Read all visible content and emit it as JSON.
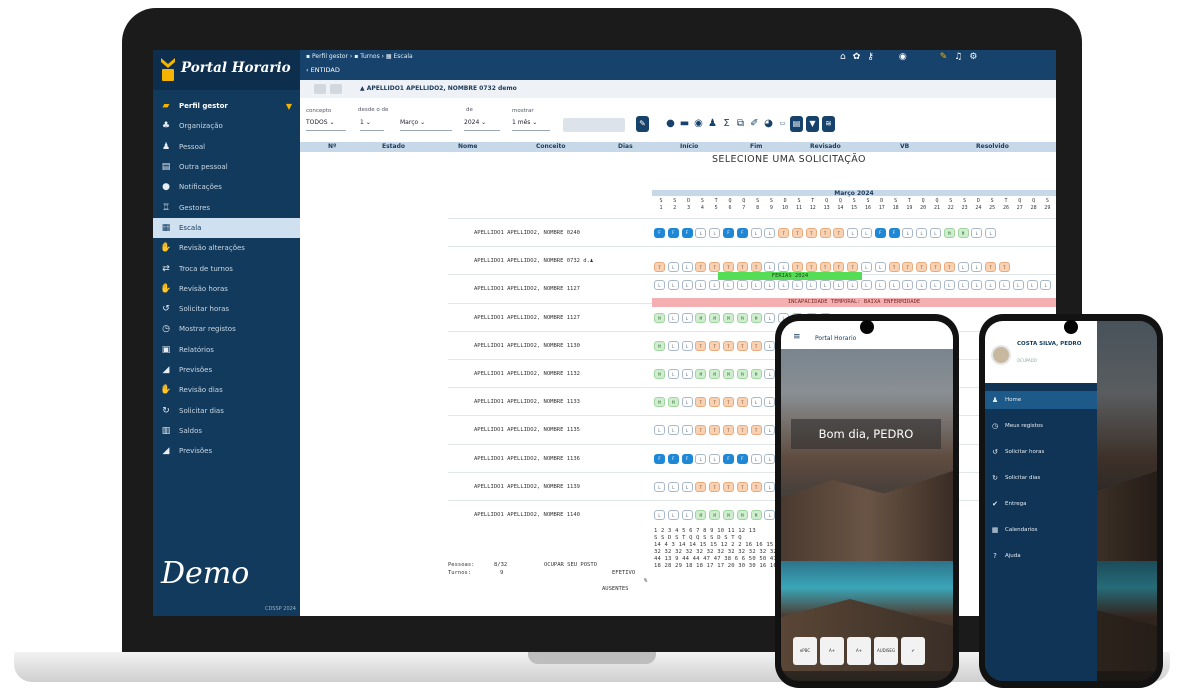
{
  "app": {
    "brand": "Portal Horario",
    "demo_label": "Demo",
    "copyright": "CDSSP 2024"
  },
  "sidebar": {
    "items": [
      {
        "label": "Perfil gestor",
        "icon": "briefcase-icon",
        "glyph": "▰"
      },
      {
        "label": "Organização",
        "icon": "org-chart-icon",
        "glyph": "♣"
      },
      {
        "label": "Pessoal",
        "icon": "people-icon",
        "glyph": "♟"
      },
      {
        "label": "Outra pessoal",
        "icon": "id-card-icon",
        "glyph": "▤"
      },
      {
        "label": "Notificações",
        "icon": "chat-icon",
        "glyph": "●"
      },
      {
        "label": "Gestores",
        "icon": "cart-icon",
        "glyph": "♖"
      },
      {
        "label": "Escala",
        "icon": "grid-icon",
        "glyph": "▦"
      },
      {
        "label": "Revisão alterações",
        "icon": "hand-icon",
        "glyph": "✋"
      },
      {
        "label": "Troca de turnos",
        "icon": "swap-icon",
        "glyph": "⇄"
      },
      {
        "label": "Revisão horas",
        "icon": "hand-icon",
        "glyph": "✋"
      },
      {
        "label": "Solicitar horas",
        "icon": "undo-icon",
        "glyph": "↺"
      },
      {
        "label": "Mostrar registos",
        "icon": "clock-icon",
        "glyph": "◷"
      },
      {
        "label": "Relatórios",
        "icon": "report-icon",
        "glyph": "▣"
      },
      {
        "label": "Previsões",
        "icon": "chart-icon",
        "glyph": "◢"
      },
      {
        "label": "Revisão dias",
        "icon": "hand-icon",
        "glyph": "✋"
      },
      {
        "label": "Solicitar dias",
        "icon": "refresh-icon",
        "glyph": "↻"
      },
      {
        "label": "Saldos",
        "icon": "balance-icon",
        "glyph": "▥"
      },
      {
        "label": "Previsões",
        "icon": "chart-icon",
        "glyph": "◢"
      }
    ]
  },
  "topbar": {
    "breadcrumb": "▪ Perfil gestor › ▪ Turnos › ▦ Escala",
    "entity": "‹ ENTIDAD",
    "icons": [
      "home-icon",
      "settings-icon",
      "key-icon",
      "globe-icon",
      "tools-icon",
      "headset-icon",
      "gear-icon"
    ]
  },
  "employee": {
    "name": "▲ APELLIDO1 APELLIDO2, NOMBRE 0732 demo"
  },
  "filters": {
    "labels": {
      "concepto": "concepto",
      "desde": "desde o  de",
      "de": "de",
      "mostrar": "mostrar"
    },
    "concepto": "TODOS  ⌄",
    "dia": "1  ⌄",
    "mes": "Março  ⌄",
    "ano": "2024  ⌄",
    "mostrar": "1 mês  ⌄"
  },
  "columns": [
    "Nº",
    "Estado",
    "Nome",
    "Conceito",
    "Dias",
    "Início",
    "Fim",
    "Revisado",
    "VB",
    "Resolvido"
  ],
  "select_message": "SELECIONE UMA SOLICITAÇÃO",
  "calendar": {
    "month": "Março 2024",
    "weekdays": [
      "S",
      "S",
      "D",
      "S",
      "T",
      "Q",
      "Q",
      "S",
      "S",
      "D",
      "S",
      "T",
      "Q",
      "Q",
      "S",
      "S",
      "D",
      "S",
      "T",
      "Q",
      "Q",
      "S",
      "S",
      "D",
      "S",
      "T",
      "Q",
      "Q",
      "S"
    ],
    "days": [
      "1",
      "2",
      "3",
      "4",
      "5",
      "6",
      "7",
      "8",
      "9",
      "10",
      "11",
      "12",
      "13",
      "14",
      "15",
      "16",
      "17",
      "18",
      "19",
      "20",
      "21",
      "22",
      "23",
      "24",
      "25",
      "26",
      "27",
      "28",
      "29"
    ]
  },
  "rows": [
    {
      "name": "APELLIDO1 APELLIDO2, NOMBRE 0240",
      "cells": [
        "b",
        "b",
        "b",
        "w",
        "w",
        "b",
        "b",
        "w",
        "w",
        "o",
        "o",
        "o",
        "o",
        "o",
        "w",
        "w",
        "b",
        "b",
        "w",
        "w",
        "w",
        "g",
        "g",
        "w",
        "w"
      ]
    },
    {
      "name": "APELLIDO1 APELLIDO2, NOMBRE 0732 d.♟",
      "cells": [
        "o",
        "w",
        "w",
        "o",
        "o",
        "o",
        "o",
        "o",
        "w",
        "w",
        "o",
        "o",
        "o",
        "o",
        "o",
        "w",
        "w",
        "o",
        "o",
        "o",
        "o",
        "o",
        "w",
        "w",
        "o",
        "o"
      ]
    },
    {
      "name": "APELLIDO1 APELLIDO2, NOMBRE 1127",
      "cells": []
    },
    {
      "name": "APELLIDO1 APELLIDO2, NOMBRE 1127",
      "cells": [
        "g",
        "w",
        "w",
        "g",
        "g",
        "g",
        "g",
        "g",
        "w",
        "w",
        "g",
        "g",
        "g"
      ]
    },
    {
      "name": "APELLIDO1 APELLIDO2, NOMBRE 1130",
      "cells": [
        "g",
        "w",
        "w",
        "o",
        "o",
        "o",
        "o",
        "o",
        "w",
        "w",
        "g",
        "g",
        "g"
      ]
    },
    {
      "name": "APELLIDO1 APELLIDO2, NOMBRE 1132",
      "cells": [
        "g",
        "w",
        "w",
        "g",
        "g",
        "g",
        "g",
        "g",
        "w",
        "w",
        "g",
        "g",
        "g"
      ]
    },
    {
      "name": "APELLIDO1 APELLIDO2, NOMBRE 1133",
      "cells": [
        "g",
        "g",
        "w",
        "o",
        "o",
        "o",
        "o",
        "w",
        "w",
        "w",
        "g",
        "g",
        "g"
      ]
    },
    {
      "name": "APELLIDO1 APELLIDO2, NOMBRE 1135",
      "cells": [
        "w",
        "w",
        "w",
        "o",
        "o",
        "o",
        "o",
        "o",
        "w",
        "b",
        "b",
        "w",
        "w"
      ]
    },
    {
      "name": "APELLIDO1 APELLIDO2, NOMBRE 1136",
      "cells": [
        "b",
        "b",
        "b",
        "w",
        "w",
        "b",
        "b",
        "w",
        "w",
        "g",
        "g",
        "g",
        "g"
      ]
    },
    {
      "name": "APELLIDO1 APELLIDO2, NOMBRE 1139",
      "cells": [
        "w",
        "w",
        "w",
        "o",
        "o",
        "o",
        "o",
        "o",
        "w",
        "w",
        "w",
        "w",
        "w"
      ]
    },
    {
      "name": "APELLIDO1 APELLIDO2, NOMBRE 1140",
      "cells": [
        "w",
        "w",
        "w",
        "g",
        "g",
        "g",
        "g",
        "g",
        "w",
        "w",
        "g",
        "g",
        "g"
      ]
    }
  ],
  "bars": {
    "vacation": "FERIAS 2024",
    "leave": "INCAPACIDADE TEMPORAL: BAIXA ENFERMIDADE"
  },
  "stats": {
    "pessoas_label": "Pessoas:",
    "pessoas_value": "8/32",
    "turnos_label": "Turnos:",
    "turnos_value": "9",
    "ocupar": "OCUPAR SEU POSTO",
    "efetivo": "EFETIVO",
    "percent": "%",
    "ausentes": "AUSENTES",
    "row1": "1  2  3  4  5  6  7  8  9  10 11 12 13",
    "row2": "S  S  D  S  T  Q  Q  S  S  D  S  T  Q",
    "row3": "14 4  3  14 14 15 15 12 2  2  16 16 15",
    "row4": "32 32 32 32 32 32 32 32 32 32 32 32 32",
    "row5": "44 13 9  44 44 47 47 38 6  6  50 50 47",
    "row6": "18 28 29 18 18 17 17 20 30 30 16 16 17"
  },
  "phone1": {
    "app_title": "Portal Horario",
    "greeting": "Bom dia, PEDRO",
    "badges": [
      "ePBC",
      "A+",
      "A+",
      "AUDISEG",
      "✔"
    ]
  },
  "phone2": {
    "user_name": "COSTA SILVA, PEDRO",
    "user_sub": "OCUPADO",
    "menu": [
      {
        "label": "Home",
        "icon": "user-icon",
        "glyph": "♟"
      },
      {
        "label": "Meus registos",
        "icon": "clock-icon",
        "glyph": "◷"
      },
      {
        "label": "Solicitar horas",
        "icon": "undo-icon",
        "glyph": "↺"
      },
      {
        "label": "Solicitar dias",
        "icon": "refresh-icon",
        "glyph": "↻"
      },
      {
        "label": "Entrega",
        "icon": "check-icon",
        "glyph": "✔"
      },
      {
        "label": "Calendarios",
        "icon": "calendar-icon",
        "glyph": "▦"
      },
      {
        "label": "Ajuda",
        "icon": "help-icon",
        "glyph": "?"
      }
    ]
  },
  "colors": {
    "navy": "#123a5c",
    "accent": "#f4b400",
    "blue_cell": "#1e88d6",
    "green_cell": "#cfeecf",
    "orange_cell": "#f8d2b4"
  }
}
